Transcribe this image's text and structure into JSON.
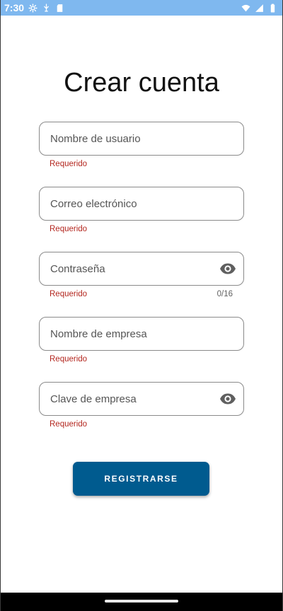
{
  "status_bar": {
    "time": "7:30",
    "left_icons": [
      "settings-gear-icon",
      "usb-debug-icon",
      "sd-card-icon"
    ],
    "right_icons": [
      "wifi-icon",
      "cell-signal-icon",
      "battery-icon"
    ],
    "color": "#7fb8ef"
  },
  "page": {
    "title": "Crear cuenta"
  },
  "form": {
    "username": {
      "label": "Nombre de usuario",
      "helper": "Requerido"
    },
    "email": {
      "label": "Correo electrónico",
      "helper": "Requerido"
    },
    "password": {
      "label": "Contraseña",
      "helper": "Requerido",
      "counter": "0/16",
      "trailing_icon": "visibility-eye-icon"
    },
    "company_name": {
      "label": "Nombre de empresa",
      "helper": "Requerido"
    },
    "company_key": {
      "label": "Clave de empresa",
      "helper": "Requerido",
      "trailing_icon": "visibility-eye-icon"
    }
  },
  "actions": {
    "register_label": "REGISTRARSE",
    "register_color": "#005b8f"
  },
  "colors": {
    "error": "#b3261e",
    "outline": "#8a8a8a"
  }
}
